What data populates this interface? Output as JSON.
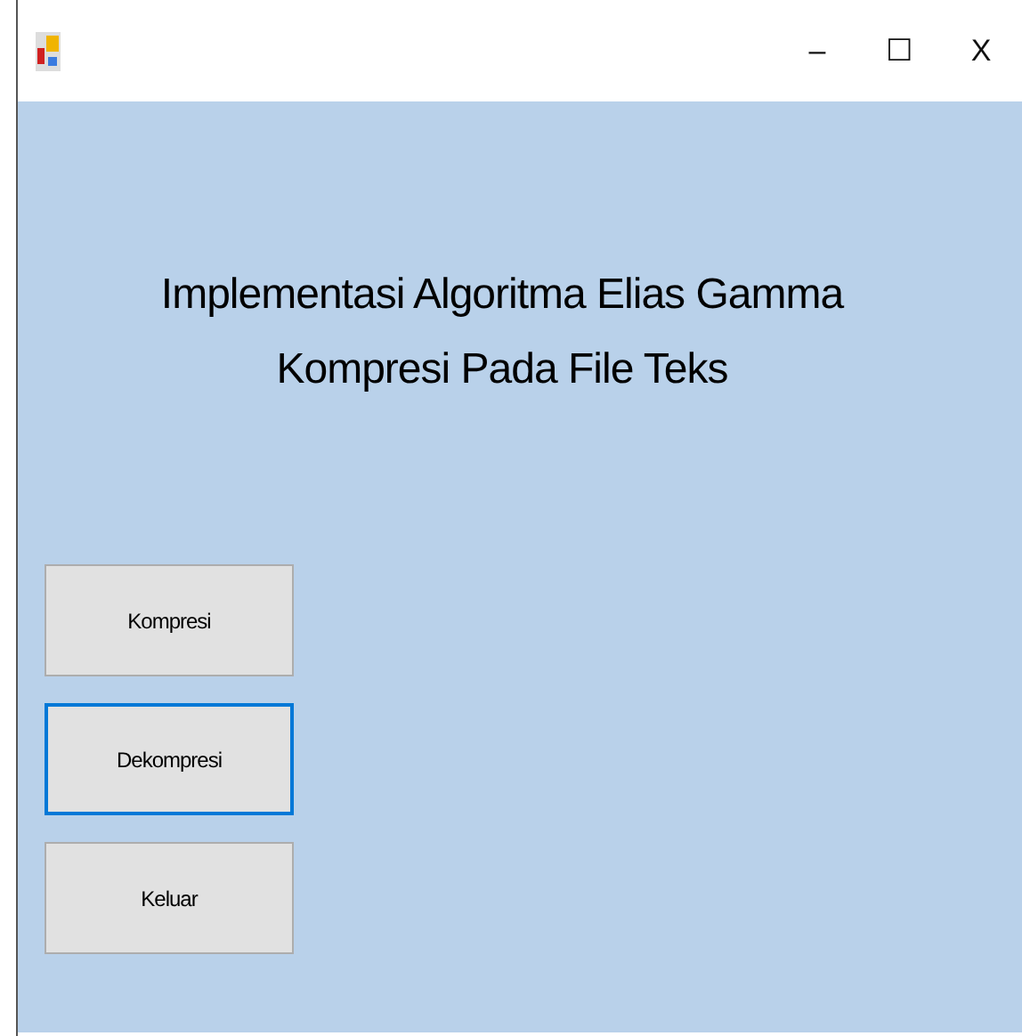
{
  "window": {
    "controls": [
      "–",
      "☐",
      "X"
    ]
  },
  "heading": [
    "Implementasi Algoritma Elias Gamma",
    "Kompresi Pada File Teks"
  ],
  "buttons": [
    {
      "label": "Kompresi",
      "focused": false
    },
    {
      "label": "Dekompresi",
      "focused": true
    },
    {
      "label": "Keluar",
      "focused": false
    }
  ]
}
